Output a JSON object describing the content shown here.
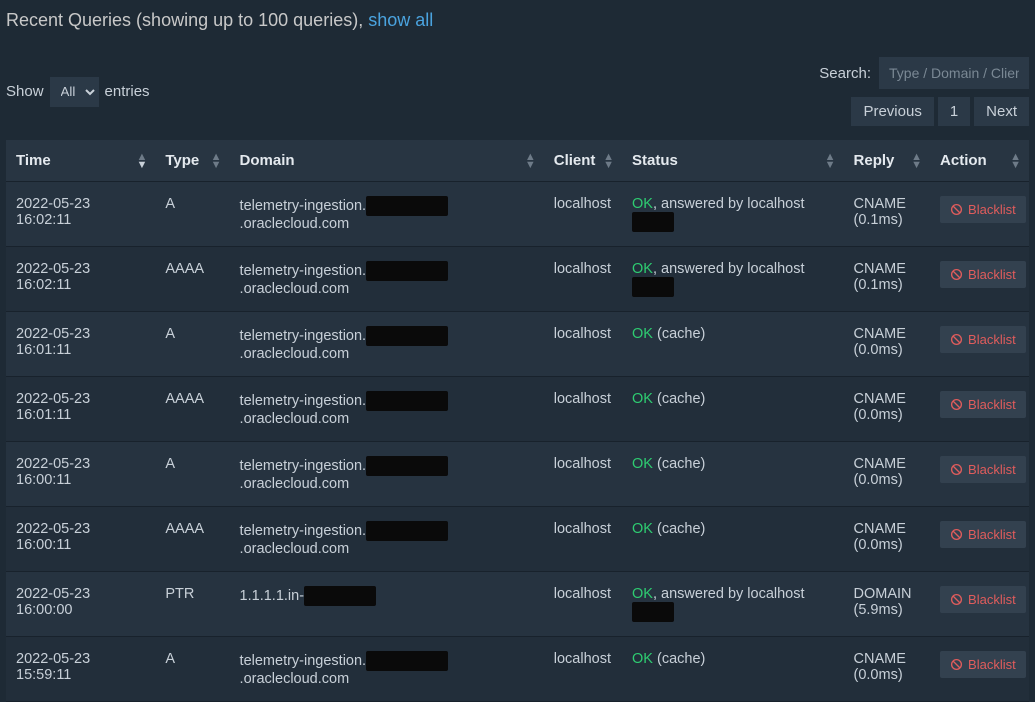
{
  "header": {
    "title_prefix": "Recent Queries (showing up to 100 queries), ",
    "show_all": "show all"
  },
  "controls": {
    "show_label_left": "Show",
    "show_label_right": "entries",
    "entries_value": "All",
    "search_label": "Search:",
    "search_placeholder": "Type / Domain / Client",
    "prev": "Previous",
    "page": "1",
    "next": "Next"
  },
  "columns": {
    "time": "Time",
    "type": "Type",
    "domain": "Domain",
    "client": "Client",
    "status": "Status",
    "reply": "Reply",
    "action": "Action"
  },
  "blacklist_label": "Blacklist",
  "rows": [
    {
      "time": "2022-05-23 16:02:11",
      "type": "A",
      "domain_pre": "telemetry-ingestion.",
      "domain_redact_w": 82,
      "domain_post": ".oraclecloud.com",
      "client": "localhost",
      "status_ok": "OK",
      "status_rest": ", answered by localhost",
      "status_redact": true,
      "status_redact_w": 42,
      "reply": "CNAME (0.1ms)"
    },
    {
      "time": "2022-05-23 16:02:11",
      "type": "AAAA",
      "domain_pre": "telemetry-ingestion.",
      "domain_redact_w": 82,
      "domain_post": ".oraclecloud.com",
      "client": "localhost",
      "status_ok": "OK",
      "status_rest": ", answered by localhost",
      "status_redact": true,
      "status_redact_w": 42,
      "reply": "CNAME (0.1ms)"
    },
    {
      "time": "2022-05-23 16:01:11",
      "type": "A",
      "domain_pre": "telemetry-ingestion.",
      "domain_redact_w": 82,
      "domain_post": ".oraclecloud.com",
      "client": "localhost",
      "status_ok": "OK",
      "status_rest": " (cache)",
      "status_redact": false,
      "reply": "CNAME (0.0ms)"
    },
    {
      "time": "2022-05-23 16:01:11",
      "type": "AAAA",
      "domain_pre": "telemetry-ingestion.",
      "domain_redact_w": 82,
      "domain_post": ".oraclecloud.com",
      "client": "localhost",
      "status_ok": "OK",
      "status_rest": " (cache)",
      "status_redact": false,
      "reply": "CNAME (0.0ms)"
    },
    {
      "time": "2022-05-23 16:00:11",
      "type": "A",
      "domain_pre": "telemetry-ingestion.",
      "domain_redact_w": 82,
      "domain_post": ".oraclecloud.com",
      "client": "localhost",
      "status_ok": "OK",
      "status_rest": " (cache)",
      "status_redact": false,
      "reply": "CNAME (0.0ms)"
    },
    {
      "time": "2022-05-23 16:00:11",
      "type": "AAAA",
      "domain_pre": "telemetry-ingestion.",
      "domain_redact_w": 82,
      "domain_post": ".oraclecloud.com",
      "client": "localhost",
      "status_ok": "OK",
      "status_rest": " (cache)",
      "status_redact": false,
      "reply": "CNAME (0.0ms)"
    },
    {
      "time": "2022-05-23 16:00:00",
      "type": "PTR",
      "domain_pre": "1.1.1.1.in-",
      "domain_redact_w": 72,
      "domain_post": "",
      "client": "localhost",
      "status_ok": "OK",
      "status_rest": ", answered by localhost",
      "status_redact": true,
      "status_redact_w": 42,
      "reply": "DOMAIN (5.9ms)"
    },
    {
      "time": "2022-05-23 15:59:11",
      "type": "A",
      "domain_pre": "telemetry-ingestion.",
      "domain_redact_w": 82,
      "domain_post": ".oraclecloud.com",
      "client": "localhost",
      "status_ok": "OK",
      "status_rest": " (cache)",
      "status_redact": false,
      "reply": "CNAME (0.0ms)"
    }
  ]
}
